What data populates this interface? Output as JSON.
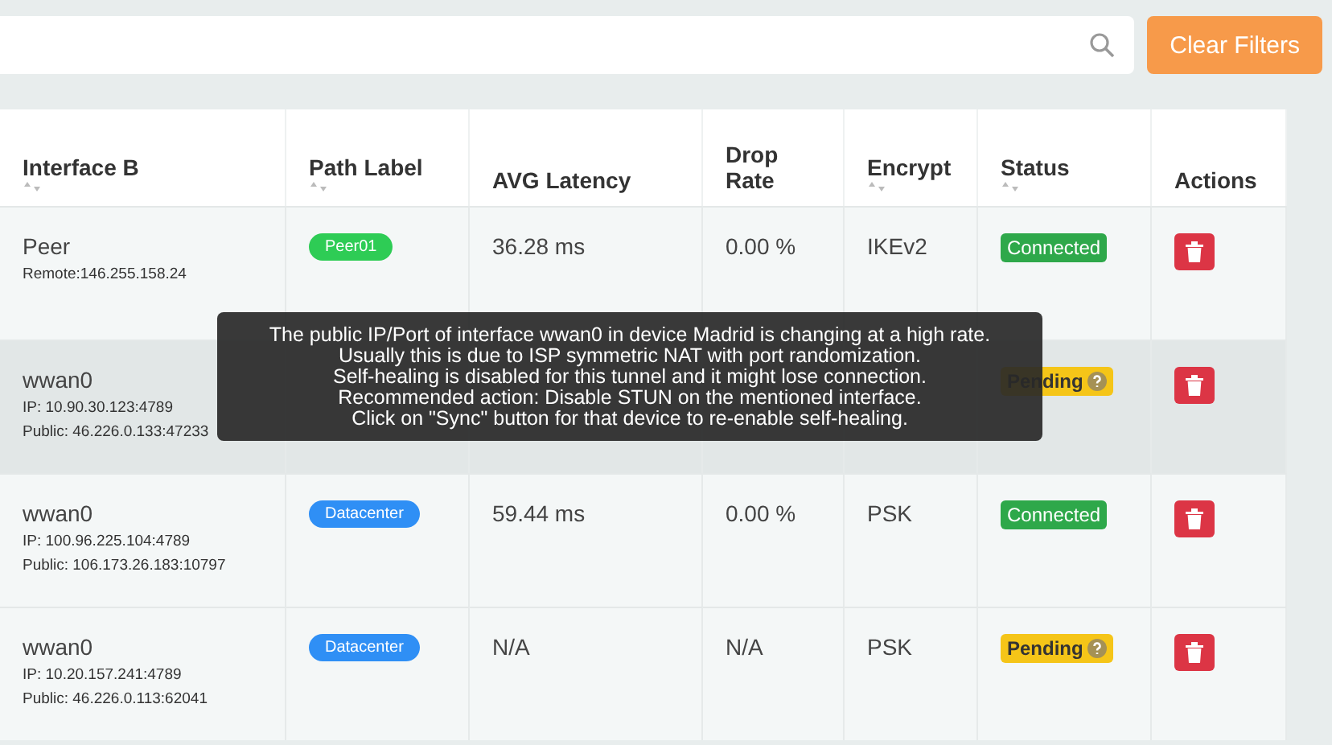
{
  "clear_button": "Clear Filters",
  "table": {
    "columns": [
      {
        "label": "Interface B",
        "sortable": true
      },
      {
        "label": "Path Label",
        "sortable": true
      },
      {
        "label": "AVG Latency",
        "sortable": false
      },
      {
        "label": "Drop Rate",
        "sortable": false
      },
      {
        "label": "Encrypt",
        "sortable": true
      },
      {
        "label": "Status",
        "sortable": true
      },
      {
        "label": "Actions",
        "sortable": false
      }
    ],
    "rows": [
      {
        "selected": false,
        "interface": [
          "Peer",
          "Remote:146.255.158.24"
        ],
        "path_label": {
          "text": "Peer01",
          "color": "#2ecc55"
        },
        "latency": "36.28 ms",
        "drop_rate": "0.00 %",
        "encrypt": "IKEv2",
        "status": {
          "text": "Connected",
          "kind": "connected"
        }
      },
      {
        "selected": true,
        "interface": [
          "wwan0",
          "IP: 10.90.30.123:4789",
          "Public: 46.226.0.133:47233"
        ],
        "status": {
          "text": "Pending",
          "kind": "pending"
        }
      },
      {
        "selected": false,
        "interface": [
          "wwan0",
          "IP: 100.96.225.104:4789",
          "Public: 106.173.26.183:10797"
        ],
        "path_label": {
          "text": "Datacenter",
          "color": "#2f8ff5"
        },
        "latency": "59.44 ms",
        "drop_rate": "0.00 %",
        "encrypt": "PSK",
        "status": {
          "text": "Connected",
          "kind": "connected"
        }
      },
      {
        "selected": false,
        "interface": [
          "wwan0",
          "IP: 10.20.157.241:4789",
          "Public: 46.226.0.113:62041"
        ],
        "path_label": {
          "text": "Datacenter",
          "color": "#2f8ff5"
        },
        "latency": "N/A",
        "drop_rate": "N/A",
        "encrypt": "PSK",
        "status": {
          "text": "Pending",
          "kind": "pending"
        }
      }
    ]
  },
  "tooltip": {
    "lines": [
      "The public IP/Port of interface wwan0 in device Madrid is changing at a high rate.",
      "Usually this is due to ISP symmetric NAT with port randomization.",
      "Self-healing is disabled for this tunnel and it might lose connection.",
      "Recommended action: Disable STUN on the mentioned interface.",
      "Click on \"Sync\" button for that device to re-enable self-healing."
    ]
  }
}
